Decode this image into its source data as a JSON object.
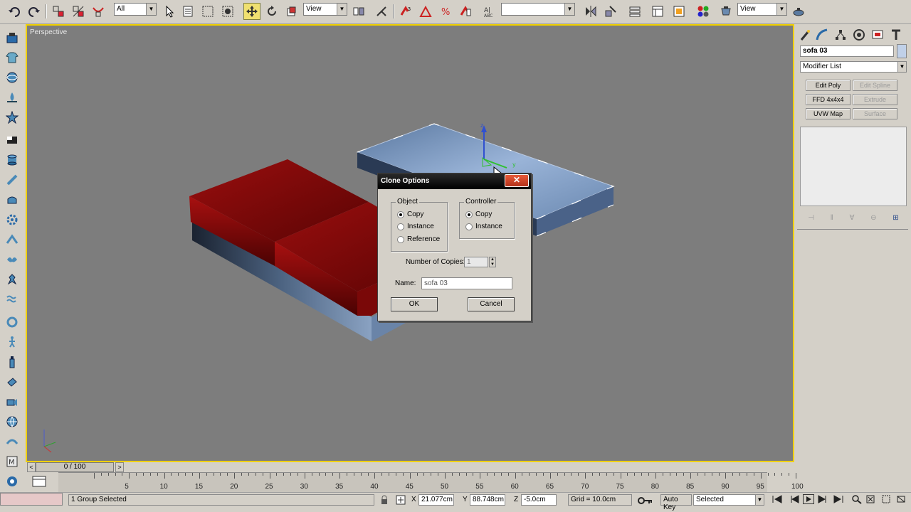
{
  "main_toolbar": {
    "selection_filter": "All",
    "ref_coord_system": "View",
    "named_selection_set": "",
    "viewport_combo": "View"
  },
  "viewport": {
    "label": "Perspective"
  },
  "command_panel": {
    "object_name": "sofa 03",
    "modifier_list": "Modifier List",
    "modifier_buttons": [
      {
        "label": "Edit Poly",
        "enabled": true
      },
      {
        "label": "Edit Spline",
        "enabled": false
      },
      {
        "label": "FFD 4x4x4",
        "enabled": true
      },
      {
        "label": "Extrude",
        "enabled": false
      },
      {
        "label": "UVW Map",
        "enabled": true
      },
      {
        "label": "Surface",
        "enabled": false
      }
    ]
  },
  "dialog": {
    "title": "Clone Options",
    "object_group": {
      "title": "Object",
      "options": [
        "Copy",
        "Instance",
        "Reference"
      ],
      "selected": "Copy"
    },
    "controller_group": {
      "title": "Controller",
      "options": [
        "Copy",
        "Instance"
      ],
      "selected": "Copy"
    },
    "copies_label": "Number of Copies:",
    "copies_value": "1",
    "name_label": "Name:",
    "name_value": "sofa 03",
    "ok_label": "OK",
    "cancel_label": "Cancel",
    "close_glyph": "✕"
  },
  "timeline": {
    "slider_label": "0 / 100",
    "ticks": [
      "5",
      "10",
      "15",
      "20",
      "25",
      "30",
      "35",
      "40",
      "45",
      "50",
      "55",
      "60",
      "65",
      "70",
      "75",
      "80",
      "85",
      "90",
      "95",
      "100"
    ]
  },
  "status_bar": {
    "selection_status": "1 Group Selected",
    "x_label": "X",
    "x_value": "21.077cm",
    "y_label": "Y",
    "y_value": "88.748cm",
    "z_label": "Z",
    "z_value": "-5.0cm",
    "grid": "Grid = 10.0cm",
    "auto_key": "Auto Key",
    "key_filter": "Selected"
  },
  "colors": {
    "viewport_bg": "#7d7d7d",
    "active_viewport_border": "#f0d000",
    "sofa_red": "#8a0a0a",
    "sofa_base": "#2f3d52",
    "sofa_selected": "#7d9cc8"
  }
}
